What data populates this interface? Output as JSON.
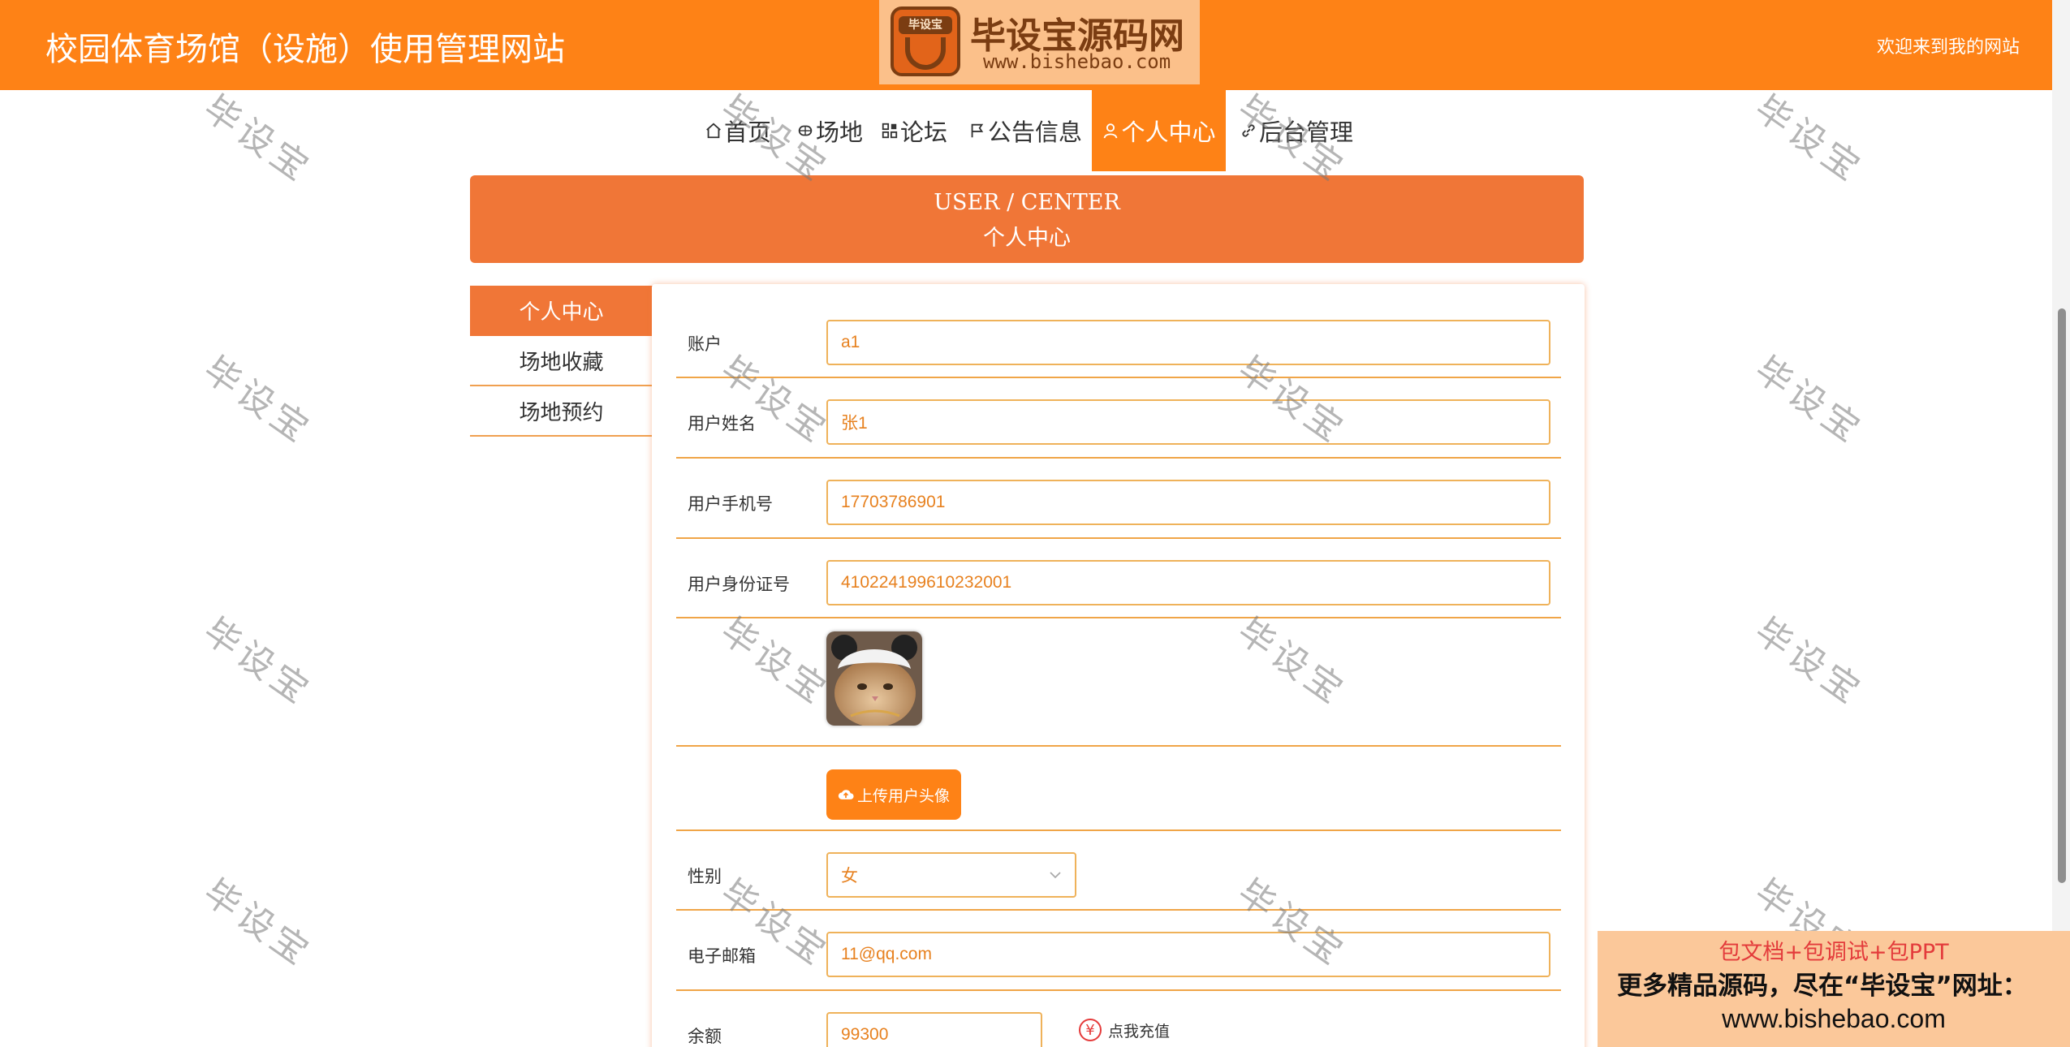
{
  "header": {
    "site_title": "校园体育场馆（设施）使用管理网站",
    "welcome": "欢迎来到我的网站",
    "logo_text": "毕设宝源码网",
    "logo_url": "www.bishebao.com",
    "logo_cap": "毕设宝"
  },
  "nav": [
    {
      "label": "首页",
      "icon": "home-icon"
    },
    {
      "label": "场地",
      "icon": "venue-icon"
    },
    {
      "label": "论坛",
      "icon": "forum-icon"
    },
    {
      "label": "公告信息",
      "icon": "flag-icon"
    },
    {
      "label": "个人中心",
      "icon": "user-icon",
      "active": true
    },
    {
      "label": "后台管理",
      "icon": "link-icon"
    }
  ],
  "banner": {
    "en": "USER / CENTER",
    "zh": "个人中心"
  },
  "side_menu": [
    {
      "label": "个人中心",
      "active": true
    },
    {
      "label": "场地收藏"
    },
    {
      "label": "场地预约"
    }
  ],
  "form": {
    "account_label": "账户",
    "account_value": "a1",
    "name_label": "用户姓名",
    "name_value": "张1",
    "phone_label": "用户手机号",
    "phone_value": "17703786901",
    "idcard_label": "用户身份证号",
    "idcard_value": "410224199610232001",
    "upload_label": "上传用户头像",
    "gender_label": "性别",
    "gender_value": "女",
    "email_label": "电子邮箱",
    "email_value": "11@qq.com",
    "balance_label": "余额",
    "balance_value": "99300",
    "recharge_label": "点我充值"
  },
  "watermark": "毕设宝",
  "ad": {
    "line1": "包文档+包调试+包PPT",
    "line2": "更多精品源码，尽在“毕设宝”网址：",
    "line3": "www.bishebao.com"
  },
  "colors": {
    "primary": "#fe8216",
    "banner": "#f07637",
    "field_text": "#e7811f",
    "border": "#efb25a"
  }
}
